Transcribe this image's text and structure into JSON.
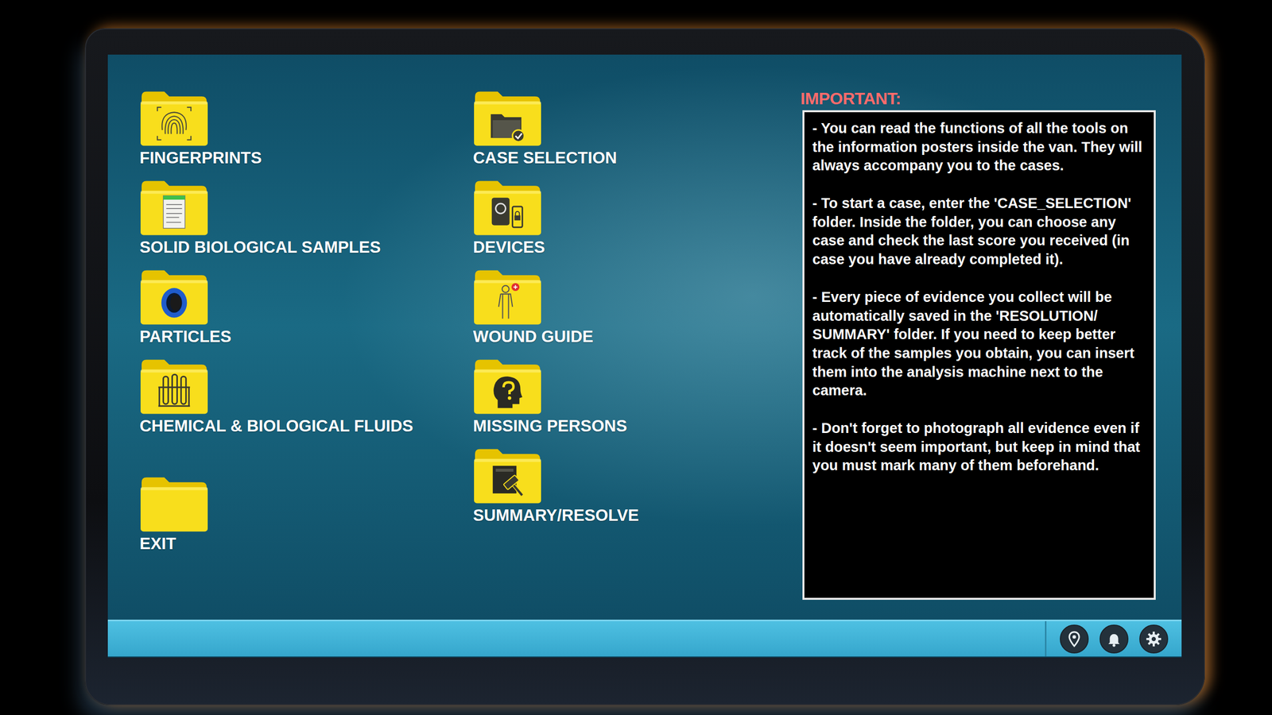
{
  "desktop": {
    "columns": [
      [
        {
          "label": "FINGERPRINTS",
          "kind": "fingerprint"
        },
        {
          "label": "SOLID BIOLOGICAL SAMPLES",
          "kind": "document"
        },
        {
          "label": "PARTICLES",
          "kind": "tape"
        },
        {
          "label": "CHEMICAL & BIOLOGICAL FLUIDS",
          "kind": "tubes"
        },
        {
          "label": "EXIT",
          "kind": "plain"
        }
      ],
      [
        {
          "label": "CASE SELECTION",
          "kind": "case"
        },
        {
          "label": "DEVICES",
          "kind": "devices"
        },
        {
          "label": "WOUND GUIDE",
          "kind": "body"
        },
        {
          "label": "MISSING PERSONS",
          "kind": "question"
        },
        {
          "label": "SUMMARY/RESOLVE",
          "kind": "gavel"
        }
      ]
    ]
  },
  "notice": {
    "title": "IMPORTANT:",
    "paragraphs": [
      "- You can read the functions of all the tools on the information posters inside the van. They will always accompany you to the cases.",
      "- To start a case, enter the 'CASE_SELECTION' folder. Inside the folder, you can choose any case and check the last score you received (in case you have already completed it).",
      "- Every piece of evidence you collect will be automatically saved in the 'RESOLUTION/ SUMMARY' folder. If you need to keep better track of the samples you obtain, you can insert them into the analysis machine next to the camera.",
      "- Don't forget to photograph all evidence even if it doesn't seem important, but keep in mind that you must mark many of them beforehand."
    ]
  }
}
